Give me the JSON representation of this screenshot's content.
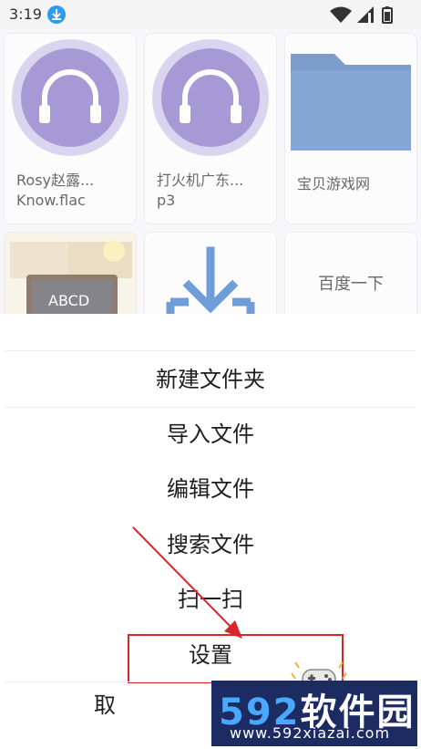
{
  "status_bar": {
    "time": "3:19",
    "icons": [
      "download-icon",
      "wifi-icon",
      "signal-icon",
      "battery-icon"
    ]
  },
  "grid": {
    "tiles": [
      {
        "label": "Rosy赵露...\nKnow.flac",
        "icon": "headphones-icon"
      },
      {
        "label": "打火机广东...\np3",
        "icon": "headphones-icon"
      },
      {
        "label": "宝贝游戏网",
        "icon": "folder-icon"
      },
      {
        "label": "",
        "icon": "chalkboard-icon"
      },
      {
        "label": "",
        "icon": "download-arrow-icon"
      },
      {
        "label": "百度一下",
        "icon": ""
      }
    ]
  },
  "sheet": {
    "items": [
      "新建文件夹",
      "导入文件",
      "编辑文件",
      "搜索文件",
      "扫一扫",
      "设置",
      "取"
    ]
  },
  "watermark": {
    "big_592": "592",
    "big_cn": "软件园",
    "url": "www.592xiazai.com",
    "board_text": "ABCD"
  },
  "colors": {
    "accent_red": "#d9262d",
    "purple": "#7b6bc2",
    "folder_blue": "#4a7ec1",
    "watermark_bg": "#1d2b63"
  }
}
